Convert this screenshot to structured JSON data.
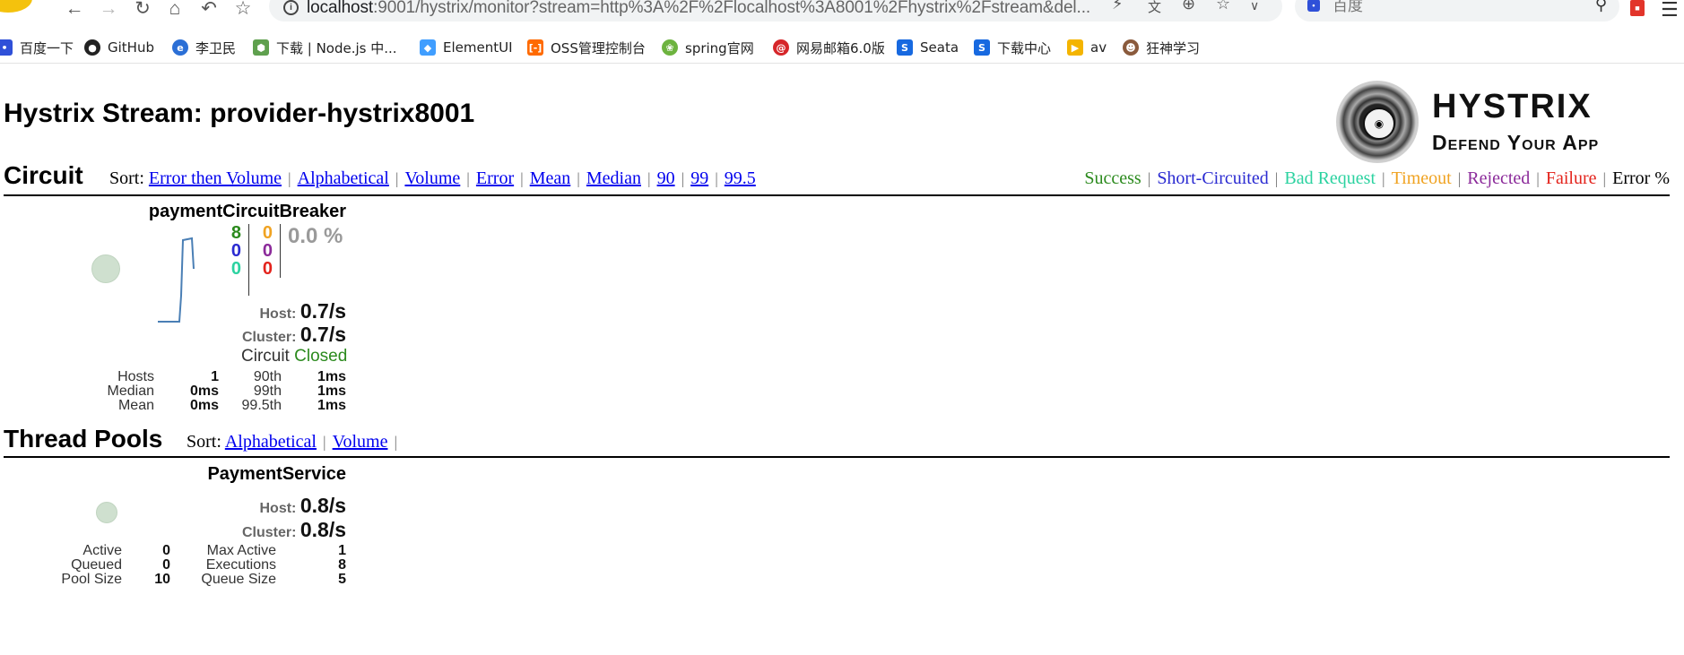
{
  "browser": {
    "url_host": "localhost",
    "url_rest": ":9001/hystrix/monitor?stream=http%3A%2F%2Flocalhost%3A8001%2Fhystrix%2Fstream&del...",
    "search_placeholder": "百度",
    "info_glyph": "i"
  },
  "bookmarks": [
    {
      "label": "百度一下",
      "icon": "baidu-icon",
      "color": "#2f50d8"
    },
    {
      "label": "GitHub",
      "icon": "github-icon",
      "color": "#222222"
    },
    {
      "label": "李卫民",
      "icon": "edge-icon",
      "color": "#2b6fd6"
    },
    {
      "label": "下载 | Node.js 中...",
      "icon": "nodejs-icon",
      "color": "#5fa04e"
    },
    {
      "label": "ElementUI",
      "icon": "elementui-icon",
      "color": "#409eff"
    },
    {
      "label": "OSS管理控制台",
      "icon": "aliyun-icon",
      "color": "#ff6a00"
    },
    {
      "label": "spring官网",
      "icon": "spring-icon",
      "color": "#6db33f"
    },
    {
      "label": "网易邮箱6.0版",
      "icon": "netease-icon",
      "color": "#d6262a"
    },
    {
      "label": "Seata",
      "icon": "seata-icon",
      "color": "#1769e0"
    },
    {
      "label": "下载中心",
      "icon": "seata-icon",
      "color": "#1769e0"
    },
    {
      "label": "av",
      "icon": "folder-icon",
      "color": "#f4b400"
    },
    {
      "label": "狂神学习",
      "icon": "avatar-icon",
      "color": "#8a5a3c"
    }
  ],
  "dashboard": {
    "title": "Hystrix Stream: provider-hystrix8001",
    "logo_title": "HYSTRIX",
    "logo_subtitle": "Defend Your App",
    "circuit": {
      "heading": "Circuit",
      "sort_label": "Sort:",
      "sort_options": [
        "Error then Volume",
        "Alphabetical",
        "Volume",
        "Error",
        "Mean",
        "Median",
        "90",
        "99",
        "99.5"
      ],
      "legend": [
        "Success",
        "Short-Circuited",
        "Bad Request",
        "Timeout",
        "Rejected",
        "Failure",
        "Error %"
      ]
    },
    "circuit_card": {
      "name": "paymentCircuitBreaker",
      "success": "8",
      "short_circuited": "0",
      "bad_request": "0",
      "timeout": "0",
      "rejected": "0",
      "failure": "0",
      "error_pct": "0.0 %",
      "host_label": "Host:",
      "host_rate": "0.7/s",
      "cluster_label": "Cluster:",
      "cluster_rate": "0.7/s",
      "circuit_label": "Circuit",
      "circuit_state": "Closed",
      "stats": {
        "hosts_label": "Hosts",
        "hosts": "1",
        "median_label": "Median",
        "median": "0ms",
        "mean_label": "Mean",
        "mean": "0ms",
        "p90_label": "90th",
        "p90": "1ms",
        "p99_label": "99th",
        "p99": "1ms",
        "p995_label": "99.5th",
        "p995": "1ms"
      }
    },
    "thread_pools": {
      "heading": "Thread Pools",
      "sort_label": "Sort:",
      "sort_options": [
        "Alphabetical",
        "Volume"
      ]
    },
    "pool_card": {
      "name": "PaymentService",
      "host_label": "Host:",
      "host_rate": "0.8/s",
      "cluster_label": "Cluster:",
      "cluster_rate": "0.8/s",
      "stats": {
        "active_label": "Active",
        "active": "0",
        "queued_label": "Queued",
        "queued": "0",
        "pool_size_label": "Pool Size",
        "pool_size": "10",
        "max_active_label": "Max Active",
        "max_active": "1",
        "executions_label": "Executions",
        "executions": "8",
        "queue_size_label": "Queue Size",
        "queue_size": "5"
      }
    }
  }
}
